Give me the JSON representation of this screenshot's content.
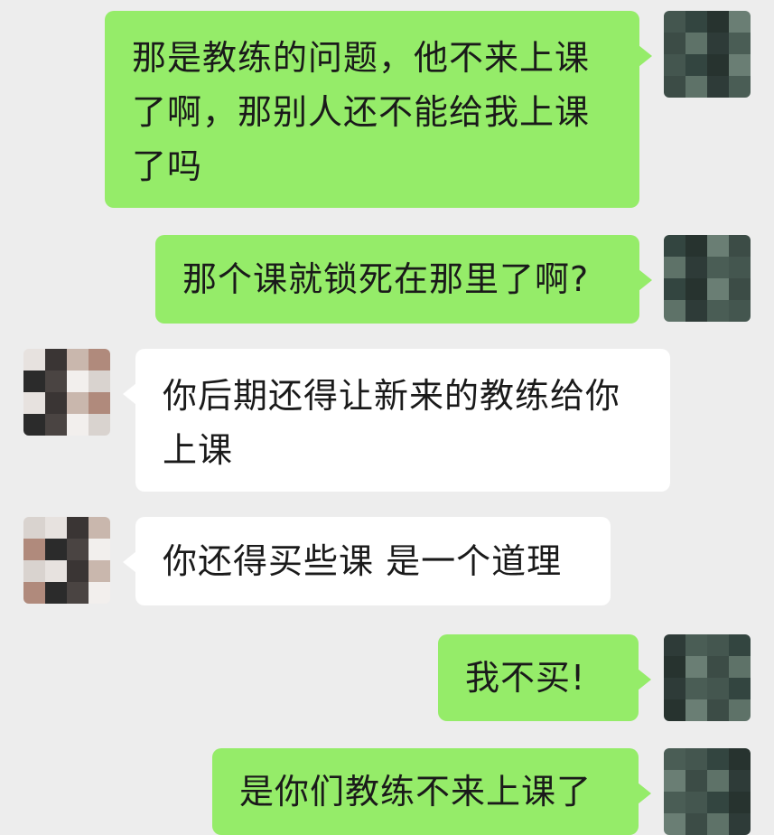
{
  "messages": [
    {
      "id": "m1",
      "side": "sent",
      "text": "那是教练的问题，他不来上课了啊，那别人还不能给我上课了吗"
    },
    {
      "id": "m2",
      "side": "sent",
      "text": "那个课就锁死在那里了啊?"
    },
    {
      "id": "m3",
      "side": "received",
      "text": "你后期还得让新来的教练给你上课"
    },
    {
      "id": "m4",
      "side": "received",
      "text": "你还得买些课 是一个道理"
    },
    {
      "id": "m5",
      "side": "sent",
      "text": "我不买!"
    },
    {
      "id": "m6",
      "side": "sent",
      "text": "是你们教练不来上课了"
    }
  ],
  "colors": {
    "background": "#ededed",
    "sent_bubble": "#95ec69",
    "received_bubble": "#ffffff",
    "text": "#1a1a1a"
  },
  "avatars": {
    "self": "pixelated-avatar-icon",
    "other": "pixelated-avatar-icon"
  }
}
